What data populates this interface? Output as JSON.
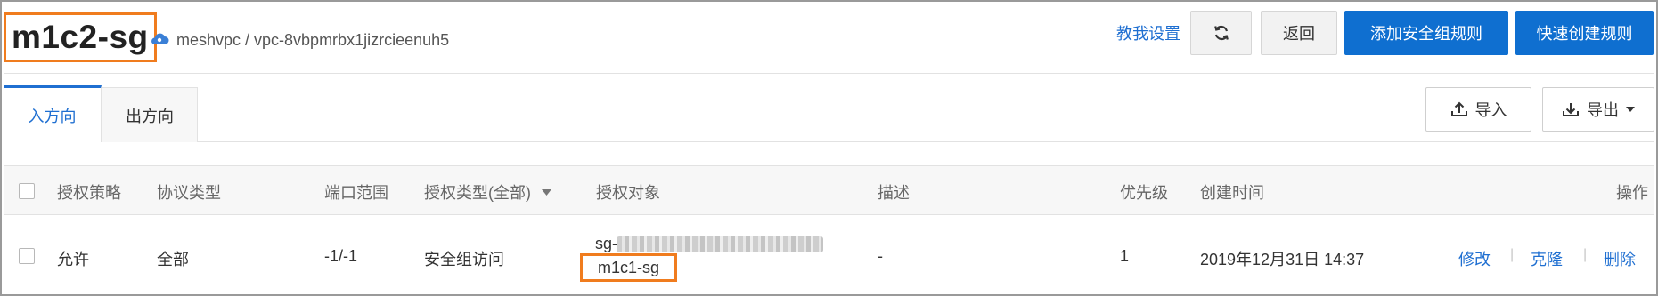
{
  "header": {
    "title": "m1c2-sg",
    "breadcrumb": "meshvpc / vpc-8vbpmrbx1jizrcieenuh5",
    "help_link": "教我设置",
    "back_label": "返回",
    "add_rule_label": "添加安全组规则",
    "quick_rule_label": "快速创建规则"
  },
  "tabs": [
    {
      "label": "入方向",
      "active": true
    },
    {
      "label": "出方向",
      "active": false
    }
  ],
  "toolbar": {
    "import_label": "导入",
    "export_label": "导出"
  },
  "table": {
    "columns": [
      "授权策略",
      "协议类型",
      "端口范围",
      "授权类型(全部)",
      "授权对象",
      "描述",
      "优先级",
      "创建时间",
      "操作"
    ],
    "rows": [
      {
        "policy": "允许",
        "protocol": "全部",
        "port_range": "-1/-1",
        "auth_type": "安全组访问",
        "auth_object_prefix": "sg-",
        "auth_object_name": "m1c1-sg",
        "description": "-",
        "priority": "1",
        "created": "2019年12月31日 14:37",
        "actions": [
          "修改",
          "克隆",
          "删除"
        ]
      }
    ]
  },
  "colors": {
    "accent": "#1f6fd1",
    "primary_button": "#0f6fd0",
    "highlight_box": "#f07c1e"
  },
  "icons": [
    "cloud-icon",
    "refresh-icon",
    "upload-icon",
    "download-icon",
    "caret-down-icon"
  ]
}
